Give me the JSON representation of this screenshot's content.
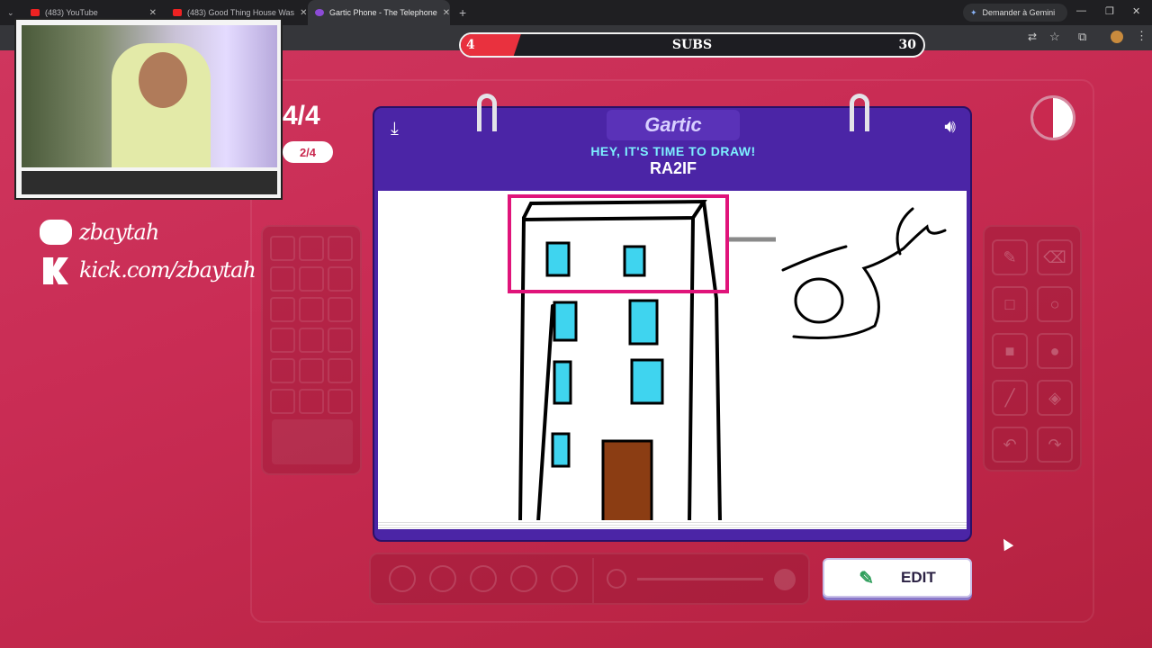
{
  "browser": {
    "tabs": [
      {
        "label": "(483) YouTube"
      },
      {
        "label": "(483) Good Thing House Was"
      },
      {
        "label": "Gartic Phone - The Telephone"
      }
    ],
    "new_tab": "+",
    "gemini_label": "Demander à Gemini"
  },
  "subs_goal": {
    "current": "4",
    "label": "SUBS",
    "target": "30",
    "progress": 0.13
  },
  "socials": {
    "discord": "zbaytah",
    "kick": "kick.com/zbaytah"
  },
  "game": {
    "round": "4/4",
    "turn": "2/4",
    "logo": "Gartic",
    "prompt": "HEY, IT'S TIME TO DRAW!",
    "player": "RA2IF",
    "edit_label": "EDIT"
  },
  "colors": {
    "accent": "#4b25a6",
    "window": "#3fd4ef",
    "door": "#8b3d13",
    "highlight": "#e0147a"
  },
  "icons": [
    "download-icon",
    "volume-icon",
    "contrast-icon",
    "pencil-icon",
    "eraser-icon",
    "rect-icon",
    "ellipse-icon",
    "filled-rect-icon",
    "filled-ellipse-icon",
    "line-icon",
    "bucket-icon",
    "undo-icon",
    "redo-icon",
    "edit-pencil-icon"
  ]
}
